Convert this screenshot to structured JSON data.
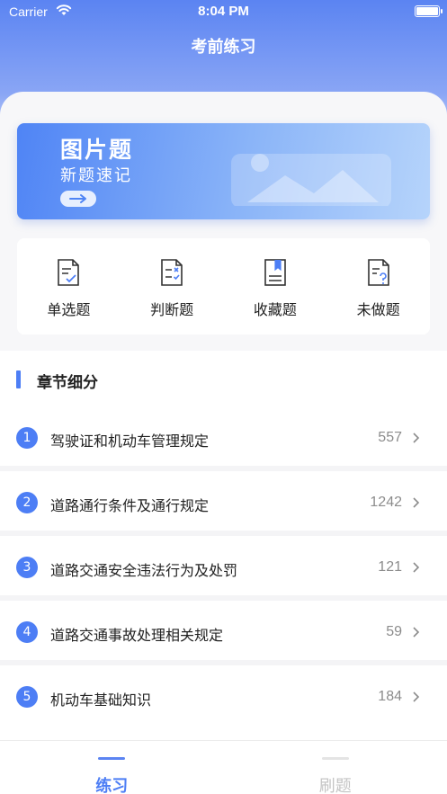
{
  "status_bar": {
    "carrier": "Carrier",
    "time": "8:04 PM"
  },
  "header": {
    "title": "考前练习"
  },
  "banner": {
    "title": "图片题",
    "subtitle": "新题速记"
  },
  "actions": [
    {
      "label": "单选题",
      "icon": "single-choice-icon"
    },
    {
      "label": "判断题",
      "icon": "true-false-icon"
    },
    {
      "label": "收藏题",
      "icon": "bookmark-icon"
    },
    {
      "label": "未做题",
      "icon": "unanswered-icon"
    }
  ],
  "chapters": {
    "title": "章节细分",
    "items": [
      {
        "num": "1",
        "name": "驾驶证和机动车管理规定",
        "count": "557"
      },
      {
        "num": "2",
        "name": "道路通行条件及通行规定",
        "count": "1242"
      },
      {
        "num": "3",
        "name": "道路交通安全违法行为及处罚",
        "count": "121"
      },
      {
        "num": "4",
        "name": "道路交通事故处理相关规定",
        "count": "59"
      },
      {
        "num": "5",
        "name": "机动车基础知识",
        "count": "184"
      }
    ]
  },
  "tabbar": {
    "tabs": [
      {
        "label": "练习",
        "active": true
      },
      {
        "label": "刷题",
        "active": false
      }
    ]
  },
  "colors": {
    "accent": "#4d7ef5",
    "header_gradient_top": "#5b84f2"
  }
}
